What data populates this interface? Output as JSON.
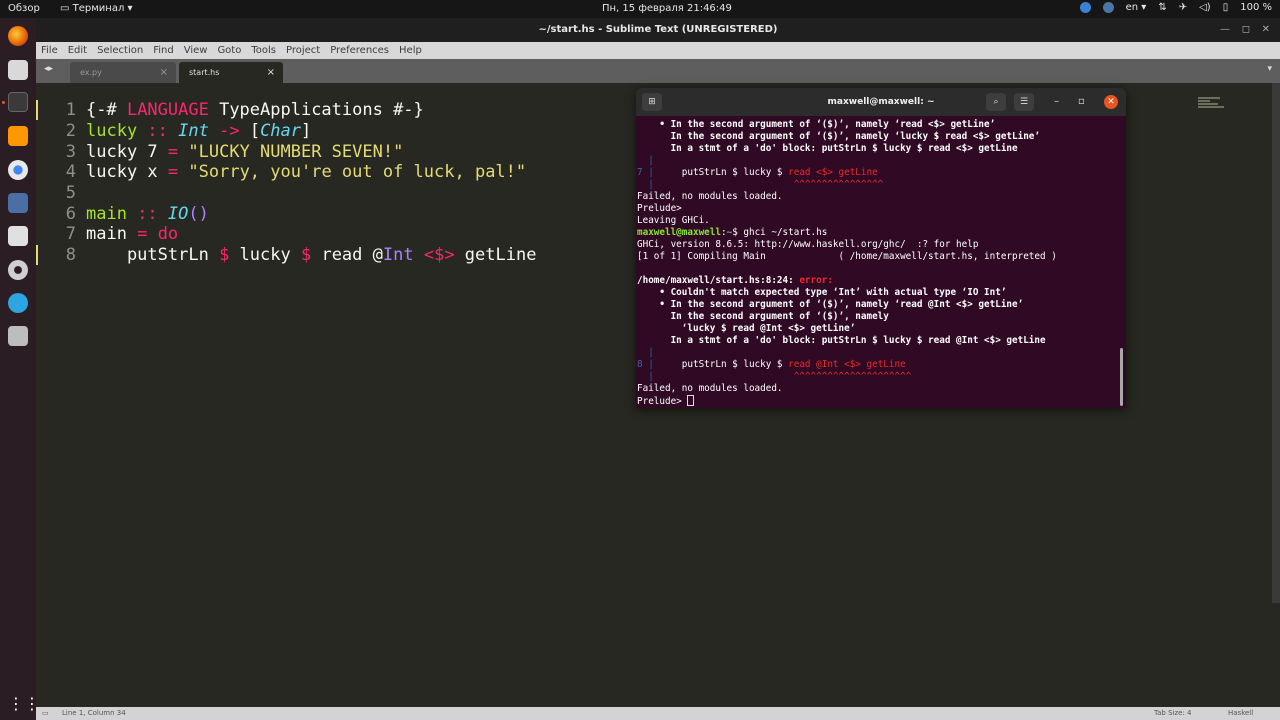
{
  "topbar": {
    "overview": "Обзор",
    "app_menu": "Терминал",
    "clock": "Пн, 15 февраля  21:46:49",
    "language": "en",
    "battery": "100 %"
  },
  "sublime": {
    "title": "~/start.hs - Sublime Text (UNREGISTERED)",
    "menu": [
      "File",
      "Edit",
      "Selection",
      "Find",
      "View",
      "Goto",
      "Tools",
      "Project",
      "Preferences",
      "Help"
    ],
    "tabs": [
      {
        "label": "ex.py",
        "active": false
      },
      {
        "label": "start.hs",
        "active": true
      }
    ],
    "line_numbers": [
      "1",
      "2",
      "3",
      "4",
      "5",
      "6",
      "7",
      "8"
    ],
    "status": {
      "position": "Line 1, Column 34",
      "tab_size": "Tab Size: 4",
      "syntax": "Haskell"
    }
  },
  "code": {
    "l1": {
      "a": "{-# ",
      "b": "LANGUAGE",
      "c": " TypeApplications #-}"
    },
    "l2": {
      "a": "lucky",
      "b": " :: ",
      "c": "Int",
      "d": " -> ",
      "e": "[",
      "f": "Char",
      "g": "]"
    },
    "l3": {
      "a": "lucky 7 ",
      "b": "=",
      "c": " ",
      "d": "\"LUCKY NUMBER SEVEN!\""
    },
    "l4": {
      "a": "lucky x ",
      "b": "=",
      "c": " ",
      "d": "\"Sorry, you're out of luck, pal!\""
    },
    "l6": {
      "a": "main",
      "b": " :: ",
      "c": "IO",
      "d": "()"
    },
    "l7": {
      "a": "main ",
      "b": "=",
      "c": " ",
      "d": "do"
    },
    "l8": {
      "a": "    putStrLn ",
      "b": "$",
      "c": " lucky ",
      "d": "$",
      "e": " read @",
      "f": "Int",
      "g": " ",
      "h": "<$>",
      "i": " getLine"
    }
  },
  "terminal": {
    "title": "maxwell@maxwell: ~",
    "lines": {
      "t1": "    • In the second argument of ‘($)’, namely ‘read <$> getLine’",
      "t2": "      In the second argument of ‘($)’, namely ‘lucky $ read <$> getLine’",
      "t3": "      In a stmt of a 'do' block: putStrLn $ lucky $ read <$> getLine",
      "t4_bar": "  |",
      "t5_num": "7 |",
      "t5_code": "     putStrLn $ lucky $ ",
      "t5_err": "read <$> getLine",
      "t6_bar": "  |",
      "t6_carets": "                         ^^^^^^^^^^^^^^^^",
      "t7": "Failed, no modules loaded.",
      "t8": "Prelude>",
      "t9": "Leaving GHCi.",
      "t10_user": "maxwell@maxwell",
      "t10_colon": ":",
      "t10_path": "~",
      "t10_cmd": "$ ghci ~/start.hs",
      "t11": "GHCi, version 8.6.5: http://www.haskell.org/ghc/  :? for help",
      "t12": "[1 of 1] Compiling Main             ( /home/maxwell/start.hs, interpreted )",
      "t13_loc": "/home/maxwell/start.hs:8:24: ",
      "t13_err": "error:",
      "t14": "    • Couldn't match expected type ‘Int’ with actual type ‘IO Int’",
      "t15": "    • In the second argument of ‘($)’, namely ‘read @Int <$> getLine’",
      "t16": "      In the second argument of ‘($)’, namely",
      "t17": "        ‘lucky $ read @Int <$> getLine’",
      "t18": "      In a stmt of a 'do' block: putStrLn $ lucky $ read @Int <$> getLine",
      "t19_bar": "  |",
      "t20_num": "8 |",
      "t20_code": "     putStrLn $ lucky $ ",
      "t20_err": "read @Int <$> getLine",
      "t21_bar": "  |",
      "t21_carets": "                         ^^^^^^^^^^^^^^^^^^^^^",
      "t22": "Failed, no modules loaded.",
      "t23": "Prelude> "
    }
  }
}
